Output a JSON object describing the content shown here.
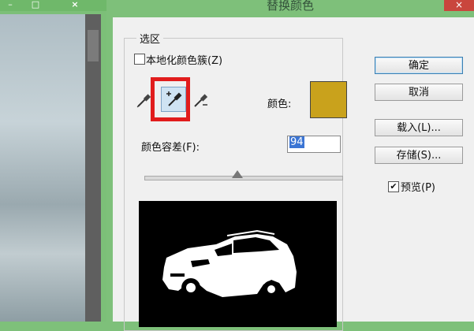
{
  "background_window": {
    "min_label": "–",
    "max_label": "□",
    "close_label": "×"
  },
  "dialog": {
    "title": "替换颜色",
    "close_label": "×"
  },
  "selection": {
    "group_title": "选区",
    "localized_clusters_label": "本地化颜色簇(Z)",
    "localized_clusters_checked": false,
    "color_label": "颜色:",
    "color_value": "#c9a21c",
    "fuzziness_label": "颜色容差(F):",
    "fuzziness_value": "94",
    "fuzziness_slider_level": 0.47,
    "tools": [
      "eyedropper-icon",
      "eyedropper-plus-icon",
      "eyedropper-minus-icon"
    ],
    "active_tool": "eyedropper-plus-icon"
  },
  "buttons": {
    "ok": "确定",
    "cancel": "取消",
    "load": "载入(L)...",
    "save": "存储(S)..."
  },
  "preview": {
    "label": "预览(P)",
    "checked": true,
    "check_mark": "✔"
  },
  "colors": {
    "highlight": "#e11c1c",
    "accent": "#3b75d4",
    "window_frame": "#7ec07a"
  }
}
